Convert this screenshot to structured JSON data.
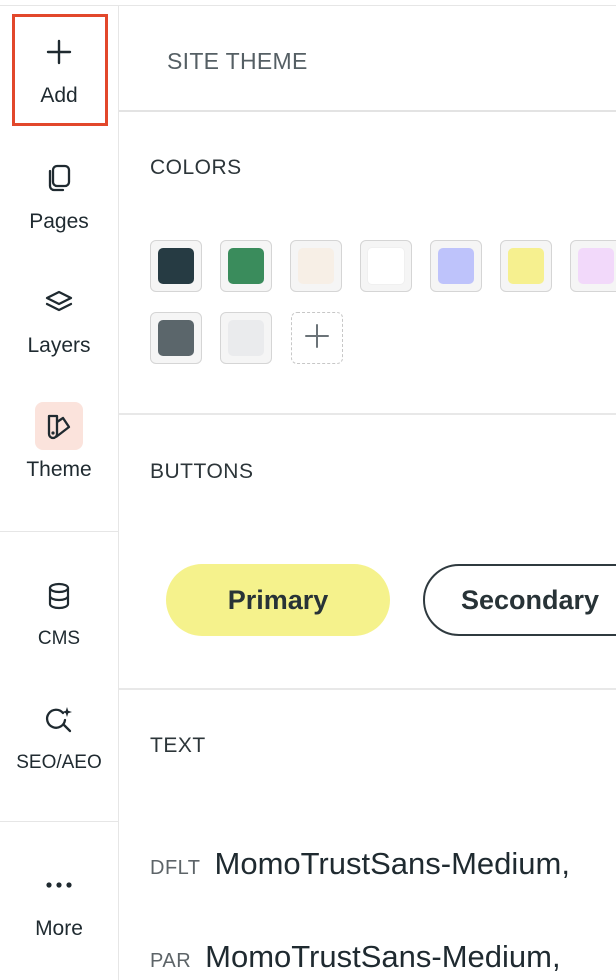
{
  "sidebar": {
    "items": [
      {
        "label": "Add",
        "icon": "plus-icon"
      },
      {
        "label": "Pages",
        "icon": "pages-icon"
      },
      {
        "label": "Layers",
        "icon": "layers-icon"
      },
      {
        "label": "Theme",
        "icon": "theme-icon",
        "active": true
      },
      {
        "label": "CMS",
        "icon": "database-icon"
      },
      {
        "label": "SEO/AEO",
        "icon": "sparkle-search-icon"
      },
      {
        "label": "More",
        "icon": "more-dots-icon"
      }
    ]
  },
  "header": {
    "title": "SITE THEME"
  },
  "colors": {
    "title": "COLORS",
    "swatches": [
      "#263b43",
      "#3a8c5c",
      "#f7efe6",
      "#ffffff",
      "#bec3fb",
      "#f6f08f",
      "#f2d9fa",
      "#5b666b",
      "#eaebed"
    ],
    "add_icon": "plus-icon"
  },
  "buttons": {
    "title": "BUTTONS",
    "primary_label": "Primary",
    "secondary_label": "Secondary",
    "primary_color": "#f5f28c"
  },
  "text": {
    "title": "TEXT",
    "rows": [
      {
        "tag": "DFLT",
        "font": "MomoTrustSans-Medium,"
      },
      {
        "tag": "PAR",
        "font": "MomoTrustSans-Medium,"
      }
    ]
  },
  "highlight_color": "#e2472b"
}
